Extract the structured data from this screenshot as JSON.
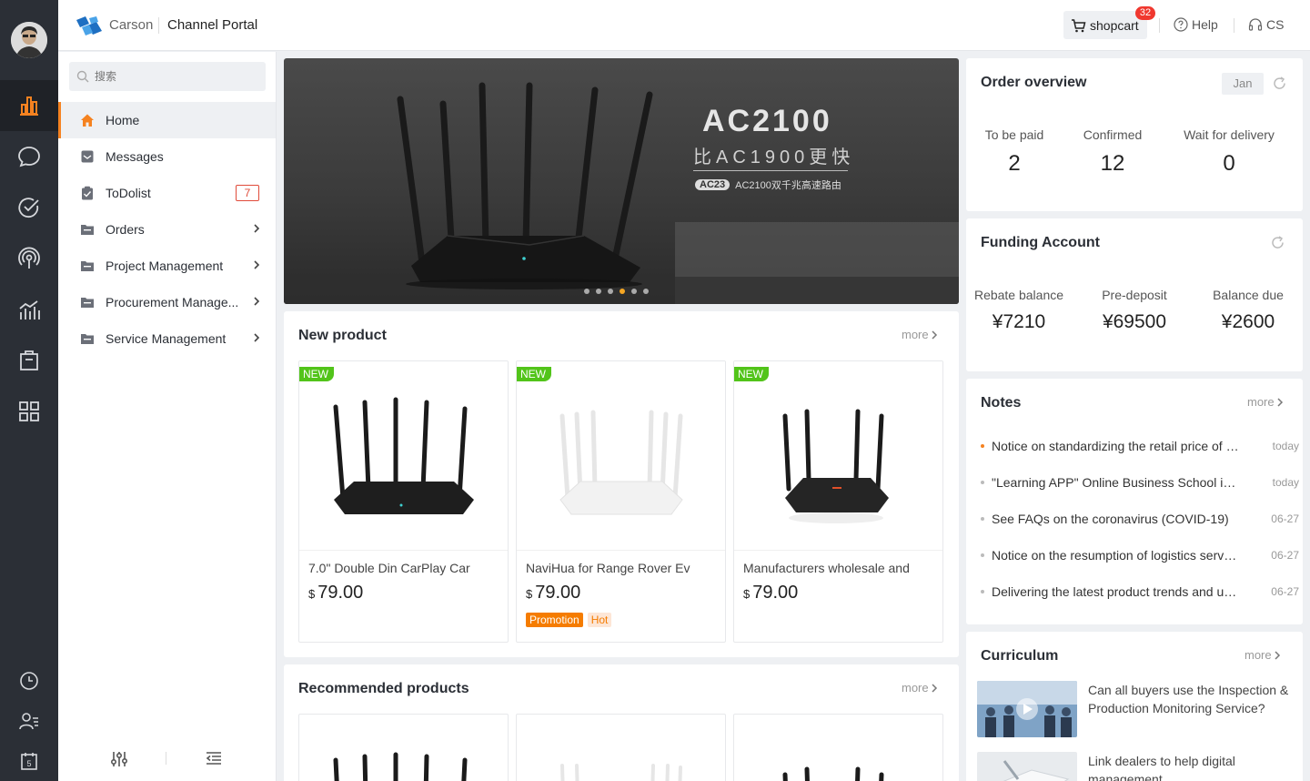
{
  "header": {
    "brand": "Carson",
    "portal_title": "Channel Portal",
    "cart_label": "shopcart",
    "cart_count": "32",
    "help_label": "Help",
    "cs_label": "CS"
  },
  "sidebar": {
    "search_placeholder": "搜索",
    "items": [
      {
        "label": "Home"
      },
      {
        "label": "Messages"
      },
      {
        "label": "ToDolist",
        "count": "7"
      },
      {
        "label": "Orders"
      },
      {
        "label": "Project Management"
      },
      {
        "label": "Procurement Manage..."
      },
      {
        "label": "Service Management"
      }
    ]
  },
  "banner": {
    "title": "AC2100",
    "subtitle": "比AC1900更快",
    "chip": "AC23",
    "tagline": "AC2100双千兆高速路由",
    "slide_count": 6,
    "active_slide": 4
  },
  "new_product": {
    "title": "New product",
    "more": "more",
    "new_badge": "NEW",
    "items": [
      {
        "name": "7.0\" Double Din CarPlay Car",
        "currency": "$",
        "price": "79.00"
      },
      {
        "name": "NaviHua for Range Rover Ev",
        "currency": "$",
        "price": "79.00",
        "tags": [
          "Promotion",
          "Hot"
        ]
      },
      {
        "name": "Manufacturers wholesale and",
        "currency": "$",
        "price": "79.00"
      }
    ]
  },
  "recommended": {
    "title": "Recommended products",
    "more": "more"
  },
  "order_overview": {
    "title": "Order overview",
    "month": "Jan",
    "stats": [
      {
        "label": "To be paid",
        "value": "2"
      },
      {
        "label": "Confirmed",
        "value": "12"
      },
      {
        "label": "Wait for delivery",
        "value": "0"
      }
    ]
  },
  "funding": {
    "title": "Funding Account",
    "stats": [
      {
        "label": "Rebate balance",
        "value": "¥7210"
      },
      {
        "label": "Pre-deposit",
        "value": "¥69500"
      },
      {
        "label": "Balance due",
        "value": "¥2600"
      }
    ]
  },
  "notes": {
    "title": "Notes",
    "more": "more",
    "items": [
      {
        "text": "Notice on standardizing the retail price of products",
        "date": "today"
      },
      {
        "text": "\"Learning APP\" Online Business School is online",
        "date": "today"
      },
      {
        "text": "See FAQs on the coronavirus (COVID-19)",
        "date": "06-27"
      },
      {
        "text": "Notice on the resumption of logistics services",
        "date": "06-27"
      },
      {
        "text": "Delivering the latest product trends and updates",
        "date": "06-27"
      }
    ]
  },
  "curriculum": {
    "title": "Curriculum",
    "more": "more",
    "items": [
      {
        "text": "Can all buyers use the Inspection & Production Monitoring Service?"
      },
      {
        "text": "Link dealers to help digital management"
      }
    ]
  },
  "colors": {
    "accent": "#f58220",
    "rail": "#2b2f36",
    "badge": "#f0382f",
    "new_badge": "#52c41a"
  }
}
